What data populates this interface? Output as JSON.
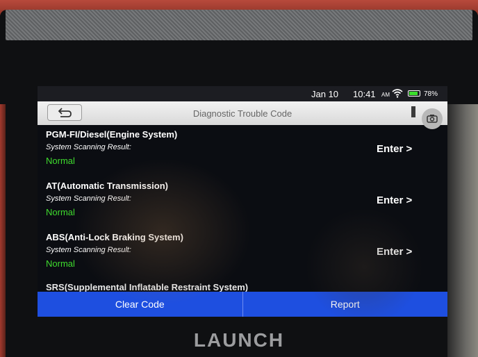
{
  "status_bar": {
    "date": "Jan 10",
    "time": "10:41",
    "ampm": "AM",
    "battery": "78%"
  },
  "title_bar": {
    "title": "Diagnostic Trouble Code"
  },
  "systems": [
    {
      "name": "PGM-FI/Diesel(Engine System)",
      "scan_label": "System Scanning Result:",
      "result": "Normal",
      "action": "Enter >"
    },
    {
      "name": "AT(Automatic Transmission)",
      "scan_label": "System Scanning Result:",
      "result": "Normal",
      "action": "Enter >"
    },
    {
      "name": "ABS(Anti-Lock Braking System)",
      "scan_label": "System Scanning Result:",
      "result": "Normal",
      "action": "Enter >"
    },
    {
      "name": "SRS(Supplemental Inflatable Restraint System)"
    }
  ],
  "bottom_bar": {
    "clear_code": "Clear Code",
    "report": "Report"
  },
  "device": {
    "brand": "LAUNCH"
  },
  "colors": {
    "result_normal": "#3fdc2e",
    "button_bar": "#1e4fe0",
    "battery": "#3adf2b"
  }
}
